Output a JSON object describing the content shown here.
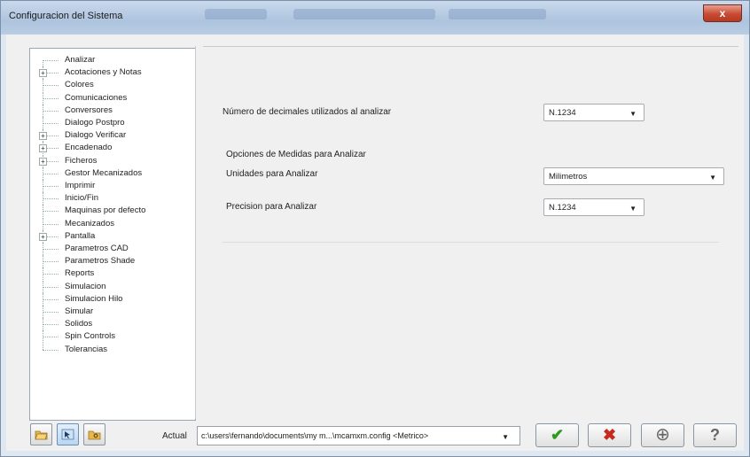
{
  "window": {
    "title": "Configuracion del Sistema",
    "close_label": "x"
  },
  "tree": {
    "items": [
      {
        "label": "Analizar",
        "expandable": false
      },
      {
        "label": "Acotaciones y Notas",
        "expandable": true
      },
      {
        "label": "Colores",
        "expandable": false
      },
      {
        "label": "Comunicaciones",
        "expandable": false
      },
      {
        "label": "Conversores",
        "expandable": false
      },
      {
        "label": "Dialogo Postpro",
        "expandable": false
      },
      {
        "label": "Dialogo Verificar",
        "expandable": true
      },
      {
        "label": "Encadenado",
        "expandable": true
      },
      {
        "label": "Ficheros",
        "expandable": true
      },
      {
        "label": "Gestor Mecanizados",
        "expandable": false
      },
      {
        "label": "Imprimir",
        "expandable": false
      },
      {
        "label": "Inicio/Fin",
        "expandable": false
      },
      {
        "label": "Maquinas por defecto",
        "expandable": false
      },
      {
        "label": "Mecanizados",
        "expandable": false
      },
      {
        "label": "Pantalla",
        "expandable": true
      },
      {
        "label": "Parametros CAD",
        "expandable": false
      },
      {
        "label": "Parametros Shade",
        "expandable": false
      },
      {
        "label": "Reports",
        "expandable": false
      },
      {
        "label": "Simulacion",
        "expandable": false
      },
      {
        "label": "Simulacion Hilo",
        "expandable": false
      },
      {
        "label": "Simular",
        "expandable": false
      },
      {
        "label": "Solidos",
        "expandable": false
      },
      {
        "label": "Spin Controls",
        "expandable": false
      },
      {
        "label": "Tolerancias",
        "expandable": false
      }
    ]
  },
  "panel": {
    "decimals_label": "Número de decimales utilizados al analizar",
    "decimals_value": "N.1234",
    "group_title": "Opciones de Medidas para Analizar",
    "units_label": "Unidades para Analizar",
    "units_value": "Milimetros",
    "precision_label": "Precision para Analizar",
    "precision_value": "N.1234"
  },
  "bottom": {
    "actual_label": "Actual",
    "path_value": "c:\\users\\fernando\\documents\\my m...\\mcamxm.config <Metrico>"
  },
  "icons": {
    "ok": "check-icon",
    "cancel": "x-icon",
    "add": "plus-circle-icon",
    "help": "question-icon"
  },
  "colors": {
    "ok": "#2e9a1e",
    "cancel": "#c8281e",
    "close": "#c94a33"
  },
  "glyphs": {
    "ok": "✔",
    "cancel": "✖",
    "add": "⊕",
    "help": "?",
    "arrow": "▼",
    "expander": "+"
  }
}
